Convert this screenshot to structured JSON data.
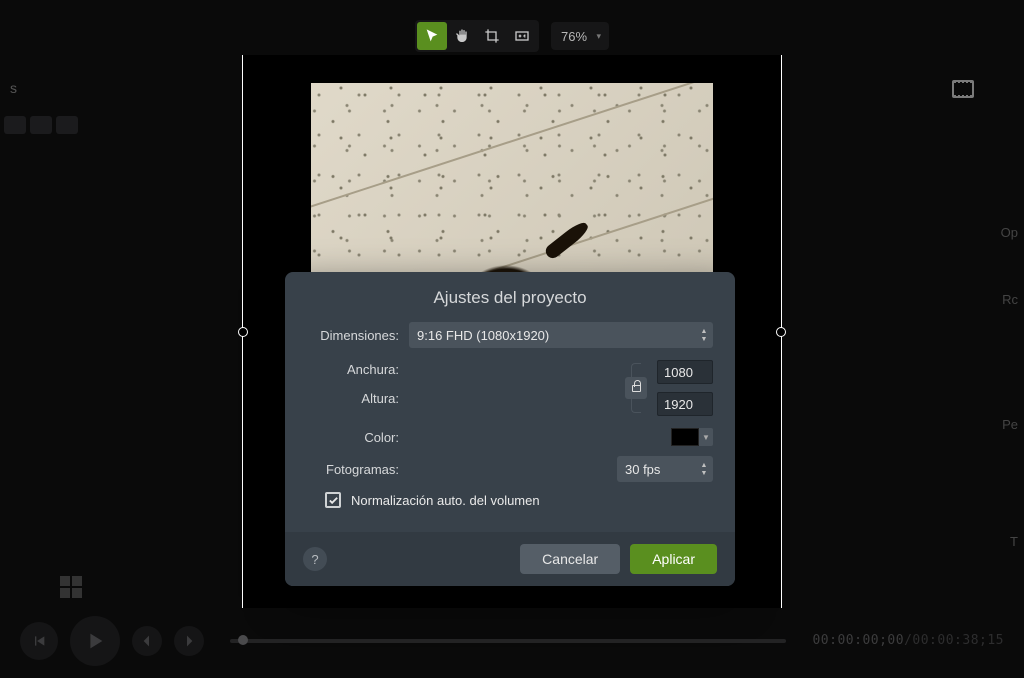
{
  "toolbar": {
    "zoom": "76%"
  },
  "rightPanel": {
    "op": "Op",
    "rc": "Rc",
    "pe": "Pe",
    "t": "T"
  },
  "dialog": {
    "title": "Ajustes del proyecto",
    "labels": {
      "dimensions": "Dimensiones:",
      "width": "Anchura:",
      "height": "Altura:",
      "color": "Color:",
      "frames": "Fotogramas:"
    },
    "dimensionsPreset": "9:16 FHD (1080x1920)",
    "width": "1080",
    "height": "1920",
    "color": "#000000",
    "fps": "30 fps",
    "autoNormLabel": "Normalización auto. del volumen",
    "autoNormChecked": true,
    "helpLabel": "?",
    "cancelLabel": "Cancelar",
    "applyLabel": "Aplicar"
  },
  "transport": {
    "current": "00:00:00;00",
    "total": "00:00:38;15"
  }
}
